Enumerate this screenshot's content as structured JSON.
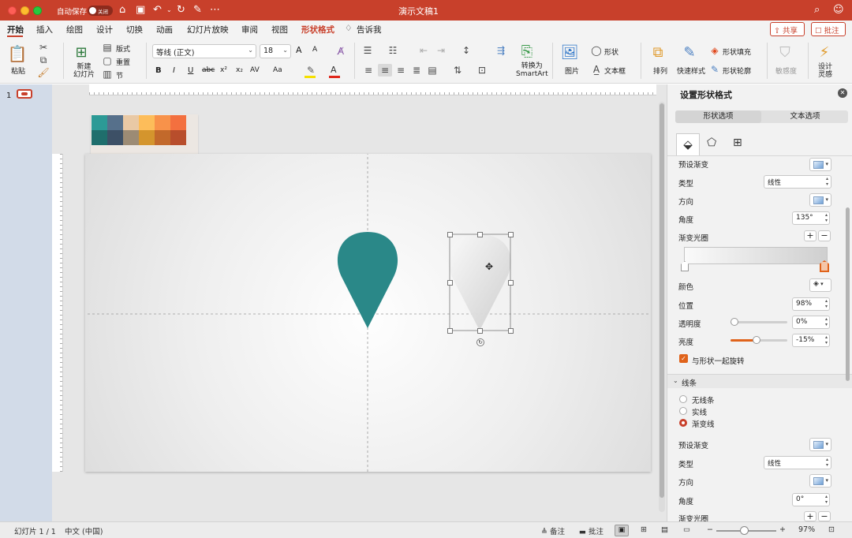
{
  "titlebar": {
    "title": "演示文稿1",
    "autosave_label": "自动保存",
    "autosave_state": "关闭"
  },
  "tabs": [
    {
      "label": "开始"
    },
    {
      "label": "插入"
    },
    {
      "label": "绘图"
    },
    {
      "label": "设计"
    },
    {
      "label": "切换"
    },
    {
      "label": "动画"
    },
    {
      "label": "幻灯片放映"
    },
    {
      "label": "审阅"
    },
    {
      "label": "视图"
    },
    {
      "label": "形状格式"
    }
  ],
  "tell_me": "告诉我",
  "share_label": "共享",
  "comment_label": "批注",
  "ribbon": {
    "paste": "粘贴",
    "new_slide": "新建\n幻灯片",
    "layout": "版式",
    "reset": "重置",
    "section": "节",
    "font_name": "等线 (正文)",
    "font_size": "18",
    "font_grow": "A",
    "font_shrink": "A",
    "bold": "B",
    "italic": "I",
    "underline": "U",
    "strike": "abc",
    "superscript": "x²",
    "subscript": "x₂",
    "char_spacing": "AV",
    "change_case": "Aa",
    "convert_smartart": "转换为\nSmartArt",
    "picture": "图片",
    "shape": "形状",
    "textbox": "文本框",
    "arrange": "排列",
    "quick_styles": "快速样式",
    "shape_fill": "形状填充",
    "shape_outline": "形状轮廓",
    "sensitivity": "敏感度",
    "designer": "设计\n灵感"
  },
  "thumbnails": [
    {
      "number": "1"
    }
  ],
  "palette": {
    "top": [
      "#2c9a96",
      "#56708b",
      "#e9c9a5",
      "#fdbd5a",
      "#f8924a",
      "#f3703f"
    ],
    "bottom": [
      "#1f6e6c",
      "#3d5066",
      "#9c8b74",
      "#d4952d",
      "#c2692b",
      "#b84e2c"
    ]
  },
  "teal_pin_color": "#2a8888",
  "pane": {
    "title": "设置形状格式",
    "tabs": [
      "形状选项",
      "文本选项"
    ],
    "fill": {
      "preset_label": "预设渐变",
      "type_label": "类型",
      "type_value": "线性",
      "direction_label": "方向",
      "angle_label": "角度",
      "angle_value": "135°",
      "stops_label": "渐变光圈",
      "color_label": "颜色",
      "position_label": "位置",
      "position_value": "98%",
      "transparency_label": "透明度",
      "transparency_value": "0%",
      "transparency_level": 0,
      "brightness_label": "亮度",
      "brightness_value": "-15%",
      "brightness_level": -0.15,
      "rotate_label": "与形状一起旋转",
      "rotate_checked": true
    },
    "line": {
      "section_label": "线条",
      "options": [
        "无线条",
        "实线",
        "渐变线"
      ],
      "selected": "渐变线",
      "preset_label": "预设渐变",
      "type_label": "类型",
      "type_value": "线性",
      "direction_label": "方向",
      "angle_label": "角度",
      "angle_value": "0°",
      "stops_label": "渐变光圈"
    }
  },
  "status": {
    "slide_info": "幻灯片 1 / 1",
    "language": "中文 (中国)",
    "notes": "备注",
    "comments": "批注",
    "zoom": "97%",
    "zoom_level": 0.97
  }
}
